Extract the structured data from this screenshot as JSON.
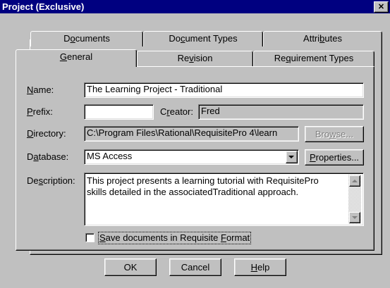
{
  "window": {
    "title": "Project (Exclusive)",
    "close_glyph": "✕"
  },
  "tabs_back": [
    {
      "pre": "D",
      "u": "o",
      "post": "cuments"
    },
    {
      "pre": "Do",
      "u": "c",
      "post": "ument Types"
    },
    {
      "pre": "Attri",
      "u": "b",
      "post": "utes"
    }
  ],
  "tabs_front": [
    {
      "pre": "",
      "u": "G",
      "post": "eneral"
    },
    {
      "pre": "Re",
      "u": "v",
      "post": "ision"
    },
    {
      "pre": "Re",
      "u": "q",
      "post": "uirement Types"
    }
  ],
  "fields": {
    "name_label": {
      "pre": "",
      "u": "N",
      "post": "ame:"
    },
    "name_value": "The Learning Project - Traditional",
    "prefix_label": {
      "pre": "",
      "u": "P",
      "post": "refix:"
    },
    "prefix_value": "",
    "creator_label": {
      "pre": "C",
      "u": "r",
      "post": "eator:"
    },
    "creator_value": "Fred",
    "directory_label": {
      "pre": "",
      "u": "D",
      "post": "irectory:"
    },
    "directory_value": "C:\\Program Files\\Rational\\RequisitePro 4\\learn",
    "browse_label": {
      "pre": "Bro",
      "u": "w",
      "post": "se..."
    },
    "database_label": {
      "pre": "D",
      "u": "a",
      "post": "tabase:"
    },
    "database_value": "MS Access",
    "properties_label": {
      "pre": "",
      "u": "P",
      "post": "roperties..."
    },
    "description_label": {
      "pre": "De",
      "u": "s",
      "post": "cription:"
    },
    "description_line1": "This project presents a learning tutorial with  RequisitePro",
    "description_line2": "skills detailed in the associatedTraditional approach.",
    "save_checkbox_label": {
      "pre": "",
      "u": "S",
      "post": "ave documents in Requisite ",
      "u2": "F",
      "post2": "ormat"
    }
  },
  "buttons": {
    "ok": "OK",
    "cancel": "Cancel",
    "help": {
      "pre": "",
      "u": "H",
      "post": "elp"
    }
  },
  "icons": {
    "dropdown": "chevron-down-icon",
    "scroll_up": "scroll-up-icon",
    "scroll_down": "scroll-down-icon"
  }
}
